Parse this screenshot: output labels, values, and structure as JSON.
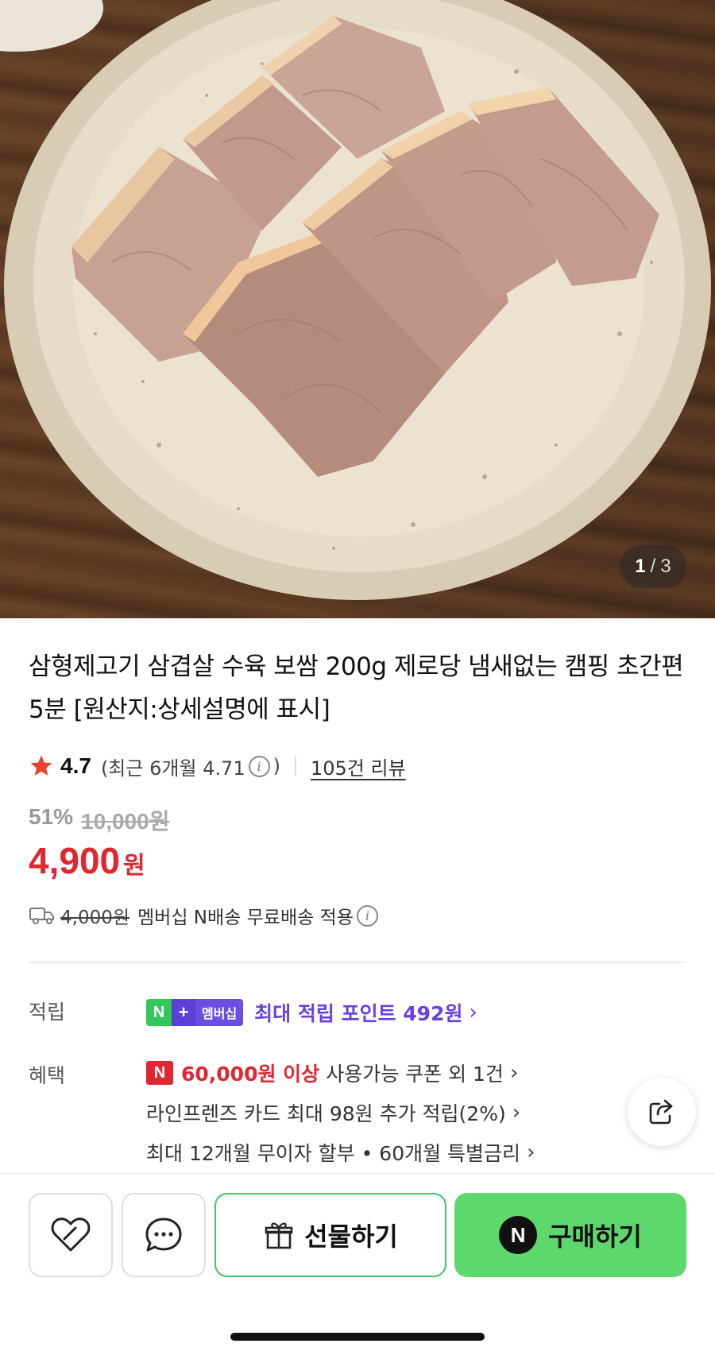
{
  "hero": {
    "counter_current": "1",
    "counter_separator": "/",
    "counter_total": "3"
  },
  "product": {
    "title": "삼형제고기 삼겹살 수육 보쌈 200g 제로당 냄새없는 캠핑 초간편 5분 [원산지:상세설명에 표시]",
    "rating": "4.7",
    "recent_rating_prefix": "(최근 6개월 4.71",
    "recent_rating_suffix": ")",
    "review_count": "105건 리뷰",
    "discount_rate": "51%",
    "original_price": "10,000원",
    "sale_price": "4,900",
    "currency": "원"
  },
  "delivery": {
    "old_fee": "4,000원",
    "text": "멤버십 N배송 무료배송 적용"
  },
  "points": {
    "label": "적립",
    "badge_n": "N",
    "badge_plus": "+",
    "badge_membership": "멤버십",
    "text": "최대 적립 포인트 492원"
  },
  "benefits": {
    "label": "혜택",
    "coupon_badge": "N",
    "coupon_amount": "60,000원 이상",
    "coupon_text": "사용가능 쿠폰 외 1건",
    "card_text": "라인프렌즈 카드 최대 98원 추가 적립(2%)",
    "installment_text": "최대 12개월 무이자 할부 • 60개월 특별금리"
  },
  "actions": {
    "gift_label": "선물하기",
    "buy_label": "구매하기",
    "buy_badge": "N"
  },
  "colors": {
    "sale_red": "#e0262f",
    "points_purple": "#6a40e3",
    "buy_green": "#5cd86d",
    "gift_border_green": "#3fc56a",
    "star_red": "#e8412e"
  },
  "icons": [
    "star-icon",
    "info-icon",
    "truck-icon",
    "chevron-right-icon",
    "share-icon",
    "heart-icon",
    "chat-icon",
    "gift-icon"
  ]
}
